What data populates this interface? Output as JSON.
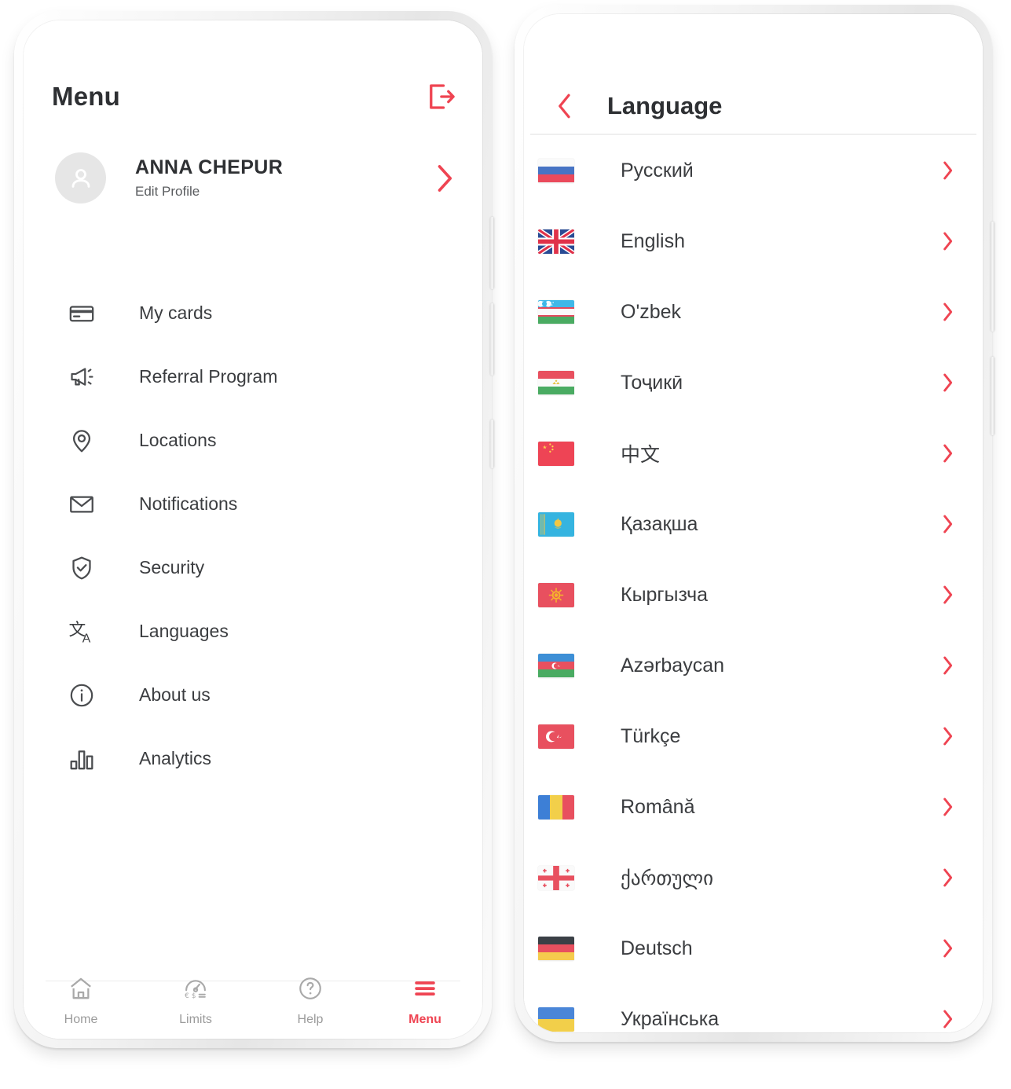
{
  "theme": {
    "accent": "#ef4452",
    "text_primary": "#2e3033",
    "text_secondary": "#595b5e",
    "icon_gray": "#4a4c4f",
    "tab_inactive": "#9b9b9b"
  },
  "menu_screen": {
    "title": "Menu",
    "logout_icon": "logout-icon",
    "profile": {
      "avatar_icon": "user-avatar-icon",
      "name": "ANNA CHEPUR",
      "subtitle": "Edit Profile",
      "chevron_icon": "chevron-right-icon"
    },
    "items": [
      {
        "label": "My cards",
        "icon": "credit-card-icon"
      },
      {
        "label": "Referral Program",
        "icon": "megaphone-icon"
      },
      {
        "label": "Locations",
        "icon": "map-pin-icon"
      },
      {
        "label": "Notifications",
        "icon": "envelope-icon"
      },
      {
        "label": "Security",
        "icon": "shield-check-icon"
      },
      {
        "label": "Languages",
        "icon": "translate-icon"
      },
      {
        "label": "About us",
        "icon": "info-circle-icon"
      },
      {
        "label": "Analytics",
        "icon": "bar-chart-icon"
      }
    ],
    "tabs": [
      {
        "label": "Home",
        "icon": "home-icon",
        "active": false
      },
      {
        "label": "Limits",
        "icon": "speedometer-icon",
        "active": false
      },
      {
        "label": "Help",
        "icon": "question-circle-icon",
        "active": false
      },
      {
        "label": "Menu",
        "icon": "hamburger-icon",
        "active": true
      }
    ]
  },
  "language_screen": {
    "back_icon": "chevron-left-icon",
    "title": "Language",
    "items": [
      {
        "label": "Русский",
        "flag": "flag-ru",
        "chevron_icon": "chevron-right-icon"
      },
      {
        "label": "English",
        "flag": "flag-gb",
        "chevron_icon": "chevron-right-icon"
      },
      {
        "label": "O'zbek",
        "flag": "flag-uz",
        "chevron_icon": "chevron-right-icon"
      },
      {
        "label": "Тоҷикӣ",
        "flag": "flag-tj",
        "chevron_icon": "chevron-right-icon"
      },
      {
        "label": "中文",
        "flag": "flag-cn",
        "chevron_icon": "chevron-right-icon"
      },
      {
        "label": "Қазақша",
        "flag": "flag-kz",
        "chevron_icon": "chevron-right-icon"
      },
      {
        "label": "Кыргызча",
        "flag": "flag-kg",
        "chevron_icon": "chevron-right-icon"
      },
      {
        "label": "Azərbaycan",
        "flag": "flag-az",
        "chevron_icon": "chevron-right-icon"
      },
      {
        "label": "Türkçe",
        "flag": "flag-tr",
        "chevron_icon": "chevron-right-icon"
      },
      {
        "label": "Română",
        "flag": "flag-ro",
        "chevron_icon": "chevron-right-icon"
      },
      {
        "label": "ქართული",
        "flag": "flag-ge",
        "chevron_icon": "chevron-right-icon"
      },
      {
        "label": "Deutsch",
        "flag": "flag-de",
        "chevron_icon": "chevron-right-icon"
      },
      {
        "label": "Українська",
        "flag": "flag-ua",
        "chevron_icon": "chevron-right-icon"
      }
    ]
  }
}
